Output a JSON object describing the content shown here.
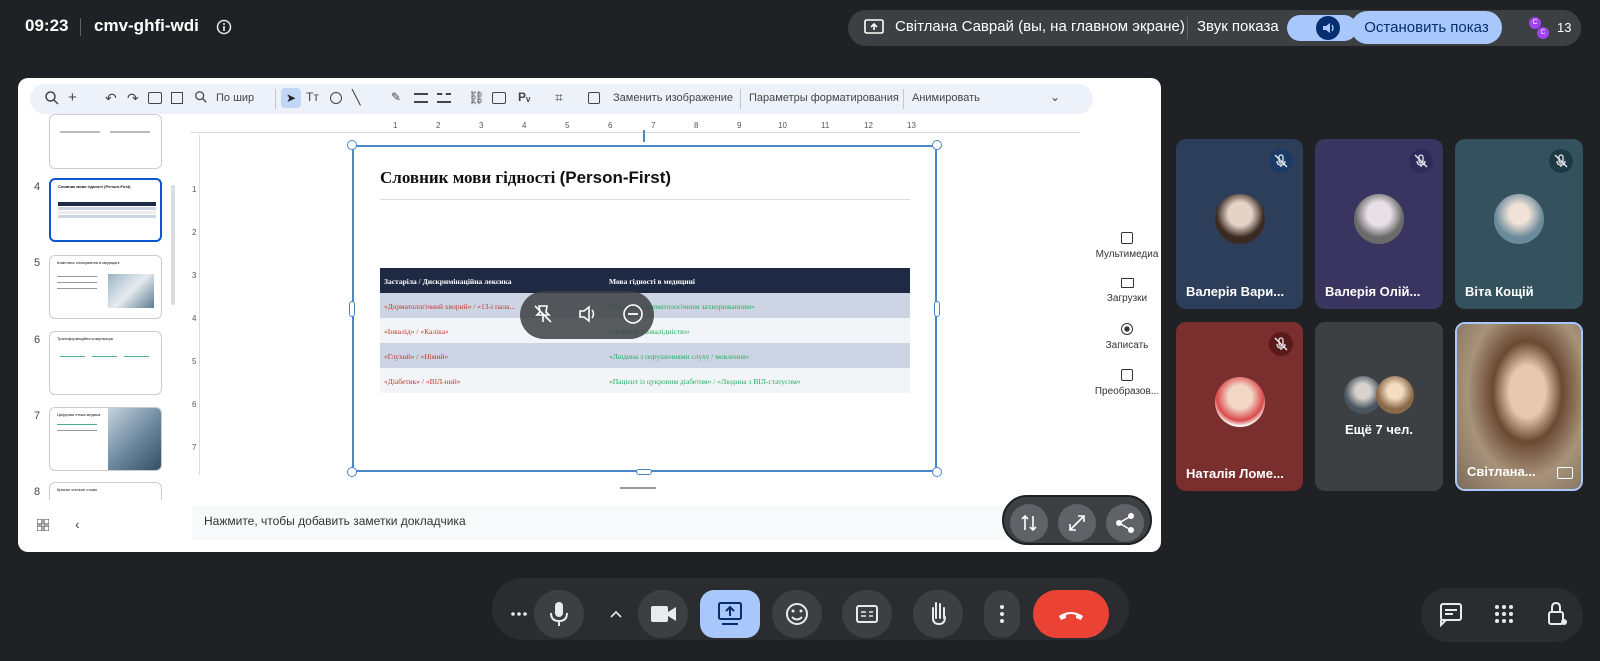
{
  "topbar": {
    "time": "09:23",
    "meeting_code": "cmv-ghfi-wdi",
    "presenting_text": "Світлана Саврай (вы, на главном экране)",
    "sound_label": "Звук показа",
    "stop_label": "Остановить показ",
    "participant_count": "13",
    "mini_avatars": [
      "C",
      "C"
    ]
  },
  "toolbar": {
    "zoom_label": "По шир",
    "replace_image": "Заменить изображение",
    "format_options": "Параметры форматирования",
    "animate": "Анимировать"
  },
  "thumbnails": [
    {
      "num": "",
      "title": ""
    },
    {
      "num": "4",
      "title": "Словник мови гідності (Person-First)"
    },
    {
      "num": "5",
      "title": "Комплекс спілкування в медицині"
    },
    {
      "num": "6",
      "title": "Трансформаційна комунікація"
    },
    {
      "num": "7",
      "title": "Цифрова етика медика"
    },
    {
      "num": "8",
      "title": "Красне спільне слово"
    }
  ],
  "ruler": {
    "top": [
      "1",
      "2",
      "3",
      "4",
      "5",
      "6",
      "7",
      "8",
      "9",
      "10",
      "11",
      "12",
      "13"
    ],
    "left": [
      "1",
      "2",
      "3",
      "4",
      "5",
      "6",
      "7"
    ]
  },
  "slide": {
    "title_serif": "Словник мови гідності ",
    "title_sans": "(Person-First)",
    "table": {
      "headers": [
        "Застаріла / Дискримінаційна лексика",
        "Мова гідності в медицині"
      ],
      "rows": [
        [
          "«Дерматологічний хворий» / «13-і пала...",
          "«Пацієнт з дерматологічним захворюванням»"
        ],
        [
          "«Інвалід» / «Каліка»",
          "«Людина з інвалідністю»"
        ],
        [
          "«Глухий» / «Німий»",
          "«Людина з порушеннями слуху / мовлення»"
        ],
        [
          "«Діабетик» / «ВІЛ-ний»",
          "«Пацієнт із цукровим діабетом» / «Людина з ВІЛ-статусом»"
        ]
      ]
    }
  },
  "side_panel": [
    {
      "label": "Мультимедиа",
      "icon": "multimedia-icon"
    },
    {
      "label": "Загрузки",
      "icon": "folder-icon"
    },
    {
      "label": "Записать",
      "icon": "record-icon"
    },
    {
      "label": "Преобразов...",
      "icon": "convert-icon"
    }
  ],
  "notes_placeholder": "Нажмите, чтобы добавить заметки докладчика",
  "participants": [
    {
      "name": "Валерія Вари...",
      "bg": "#2c3e5a",
      "muted": true
    },
    {
      "name": "Валерія Олій...",
      "bg": "#3a3560",
      "muted": true
    },
    {
      "name": "Віта Кощій",
      "bg": "#34525e",
      "muted": true
    },
    {
      "name": "Наталія Ломе...",
      "bg": "#7a2e2e",
      "muted": true
    },
    {
      "name": "Ещё 7 чел.",
      "bg": "#3c4043",
      "muted": false
    },
    {
      "name": "Світлана...",
      "bg": "#5a4a38",
      "muted": false
    }
  ],
  "colors": {
    "accent": "#a8c7fa",
    "end_call": "#ea4335",
    "active_button": "#a8c7fa",
    "background": "#202124"
  }
}
